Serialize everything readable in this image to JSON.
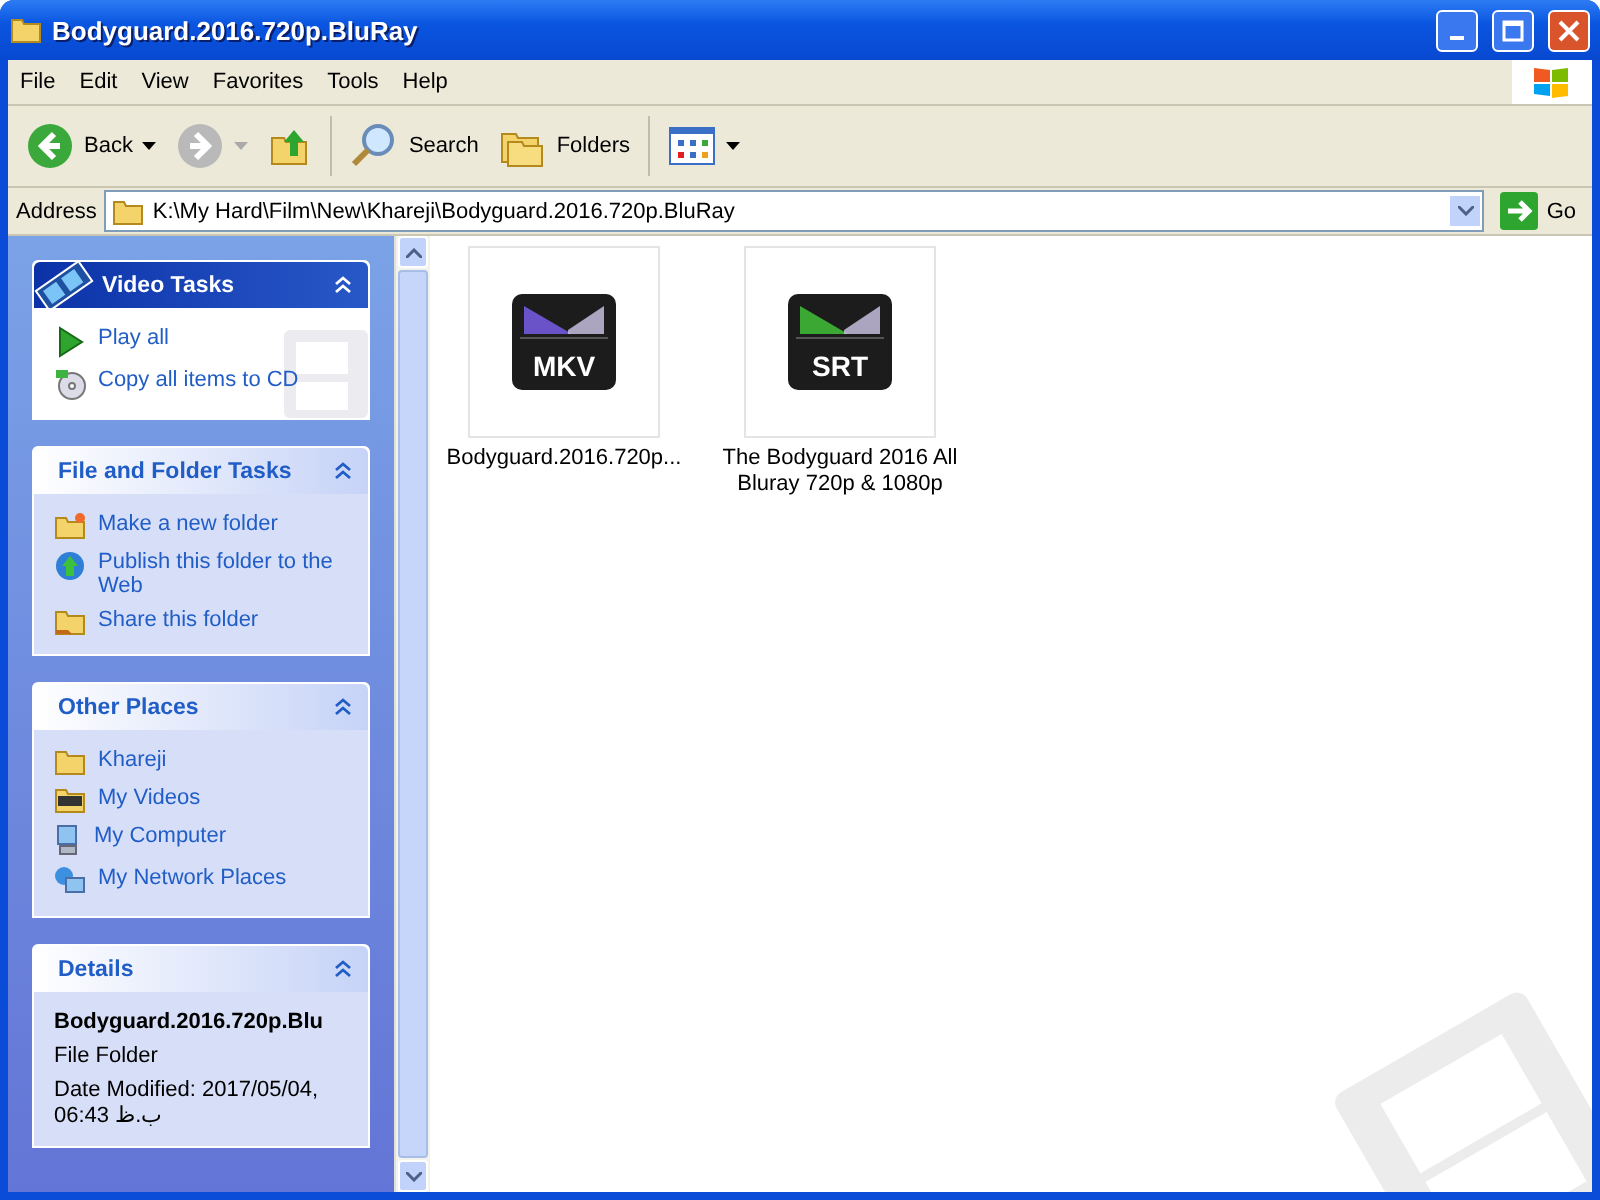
{
  "window": {
    "title": "Bodyguard.2016.720p.BluRay"
  },
  "menu": [
    "File",
    "Edit",
    "View",
    "Favorites",
    "Tools",
    "Help"
  ],
  "toolbar": {
    "back": "Back",
    "search": "Search",
    "folders": "Folders"
  },
  "address": {
    "label": "Address",
    "value": "K:\\My Hard\\Film\\New\\Khareji\\Bodyguard.2016.720p.BluRay",
    "go": "Go"
  },
  "panels": [
    {
      "kind": "special",
      "title": "Video Tasks",
      "items": [
        "Play all",
        "Copy all items to CD"
      ]
    },
    {
      "kind": "normal",
      "title": "File and Folder Tasks",
      "items": [
        "Make a new folder",
        "Publish this folder to the Web",
        "Share this folder"
      ]
    },
    {
      "kind": "normal",
      "title": "Other Places",
      "items": [
        "Khareji",
        "My Videos",
        "My Computer",
        "My Network Places"
      ]
    },
    {
      "kind": "details",
      "title": "Details",
      "name": "Bodyguard.2016.720p.Blu",
      "type": "File Folder",
      "modified": "Date Modified: 2017/05/04, 06:43 ب.ظ"
    }
  ],
  "files": [
    {
      "name": "Bodyguard.2016.720p...",
      "badge": "MKV",
      "color": "#6a52c8"
    },
    {
      "name": "The Bodyguard 2016 All Bluray 720p & 1080p",
      "badge": "SRT",
      "color": "#3aa832"
    }
  ]
}
